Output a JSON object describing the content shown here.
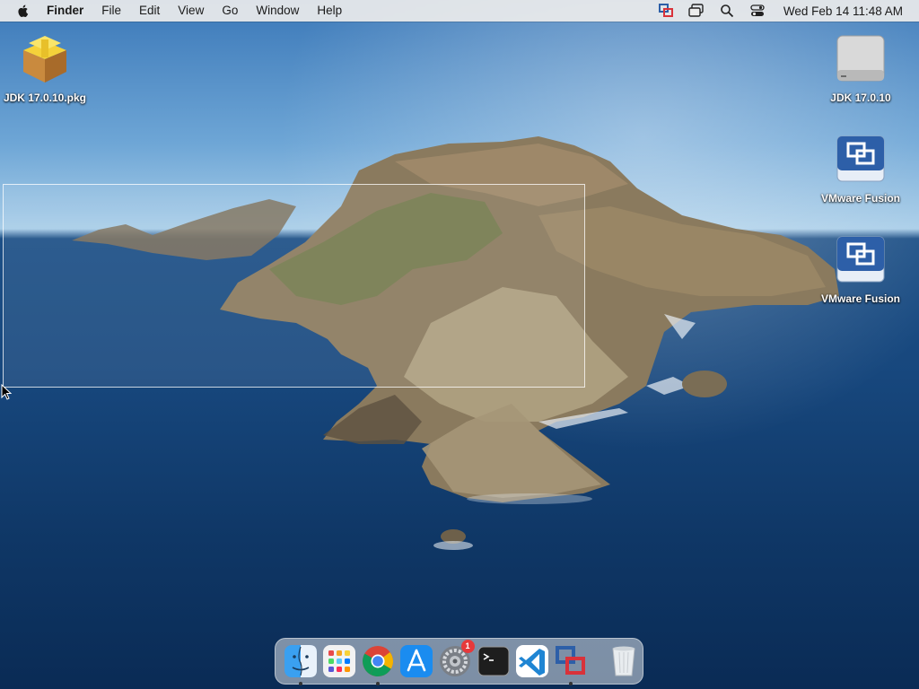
{
  "menubar": {
    "app_name": "Finder",
    "menus": [
      "File",
      "Edit",
      "View",
      "Go",
      "Window",
      "Help"
    ],
    "clock": "Wed Feb 14  11:48 AM"
  },
  "desktop_icons": [
    {
      "label": "JDK 17.0.10.pkg",
      "icon": "package-icon"
    },
    {
      "label": "JDK 17.0.10",
      "icon": "disk-image-icon"
    },
    {
      "label": "VMware Fusion",
      "icon": "vmware-fusion-icon"
    },
    {
      "label": "VMware Fusion",
      "icon": "vmware-fusion-icon"
    }
  ],
  "dock": {
    "items": [
      {
        "name": "Finder",
        "icon": "finder-icon",
        "running": true
      },
      {
        "name": "Launchpad",
        "icon": "launchpad-icon",
        "running": false
      },
      {
        "name": "Google Chrome",
        "icon": "chrome-icon",
        "running": true
      },
      {
        "name": "App Store",
        "icon": "app-store-icon",
        "running": false
      },
      {
        "name": "System Preferences",
        "icon": "system-preferences-icon",
        "running": false,
        "badge": "1"
      },
      {
        "name": "Terminal",
        "icon": "terminal-icon",
        "running": false
      },
      {
        "name": "Visual Studio Code",
        "icon": "vscode-icon",
        "running": false
      },
      {
        "name": "VMware Fusion",
        "icon": "vmware-fusion-icon",
        "running": true
      },
      {
        "name": "Trash",
        "icon": "trash-icon",
        "running": false
      }
    ]
  }
}
